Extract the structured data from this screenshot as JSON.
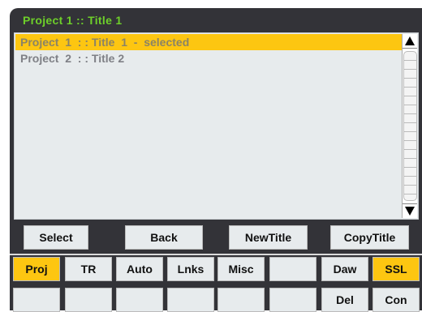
{
  "title": "Project  1  ::  Title  1",
  "list": {
    "items": [
      {
        "label": "Project  1  : : Title  1  -  selected",
        "selected": true
      },
      {
        "label": "Project  2  : : Title 2",
        "selected": false
      }
    ]
  },
  "actions": [
    "Select",
    "Back",
    "NewTitle",
    "CopyTitle"
  ],
  "tabs_row": [
    {
      "label": "Proj",
      "active": true
    },
    {
      "label": "TR",
      "active": false
    },
    {
      "label": "Auto",
      "active": false
    },
    {
      "label": "Lnks",
      "active": false
    },
    {
      "label": "Misc",
      "active": false
    },
    {
      "label": "",
      "active": false
    },
    {
      "label": "Daw",
      "active": false
    },
    {
      "label": "SSL",
      "active": true
    }
  ],
  "bottom_row": [
    "",
    "",
    "",
    "",
    "",
    "",
    "Del",
    "Con"
  ],
  "colors": {
    "accent": "#fdc611",
    "title": "#6ecf2a",
    "frame": "#333338"
  }
}
